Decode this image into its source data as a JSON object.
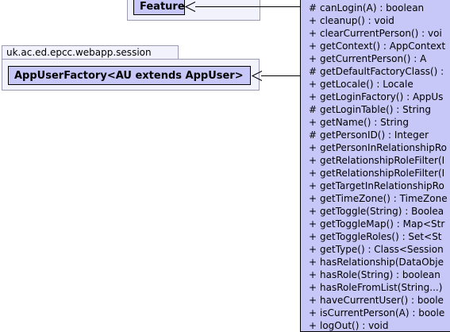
{
  "top_package": {
    "class_name": "Feature"
  },
  "session_package": {
    "package_name": "uk.ac.ed.epcc.webapp.session",
    "class_name": "AppUserFactory<AU extends AppUser>"
  },
  "main_class": {
    "methods": [
      {
        "vis": "#",
        "sig": "canLogin(A) : boolean"
      },
      {
        "vis": "+",
        "sig": "cleanup() : void"
      },
      {
        "vis": "+",
        "sig": "clearCurrentPerson() : voi"
      },
      {
        "vis": "+",
        "sig": "getContext() : AppContext"
      },
      {
        "vis": "+",
        "sig": "getCurrentPerson() : A"
      },
      {
        "vis": "#",
        "sig": "getDefaultFactoryClass() :"
      },
      {
        "vis": "+",
        "sig": "getLocale() : Locale"
      },
      {
        "vis": "+",
        "sig": "getLoginFactory() : AppUs"
      },
      {
        "vis": "#",
        "sig": "getLoginTable() : String"
      },
      {
        "vis": "+",
        "sig": "getName() : String"
      },
      {
        "vis": "#",
        "sig": "getPersonID() : Integer"
      },
      {
        "vis": "+",
        "sig": "getPersonInRelationshipRo"
      },
      {
        "vis": "+",
        "sig": "getRelationshipRoleFilter(I"
      },
      {
        "vis": "+",
        "sig": "getRelationshipRoleFilter(I"
      },
      {
        "vis": "+",
        "sig": "getTargetInRelationshipRo"
      },
      {
        "vis": "+",
        "sig": "getTimeZone() : TimeZone"
      },
      {
        "vis": "+",
        "sig": "getToggle(String) : Boolea"
      },
      {
        "vis": "+",
        "sig": "getToggleMap() : Map<Str"
      },
      {
        "vis": "+",
        "sig": "getToggleRoles() : Set<St"
      },
      {
        "vis": "+",
        "sig": "getType() : Class<Session"
      },
      {
        "vis": "+",
        "sig": "hasRelationship(DataObje"
      },
      {
        "vis": "+",
        "sig": "hasRole(String) : boolean"
      },
      {
        "vis": "+",
        "sig": "hasRoleFromList(String...)"
      },
      {
        "vis": "+",
        "sig": "haveCurrentUser() : boole"
      },
      {
        "vis": "+",
        "sig": "isCurrentPerson(A) : boole"
      },
      {
        "vis": "+",
        "sig": "logOut() : void"
      }
    ]
  }
}
